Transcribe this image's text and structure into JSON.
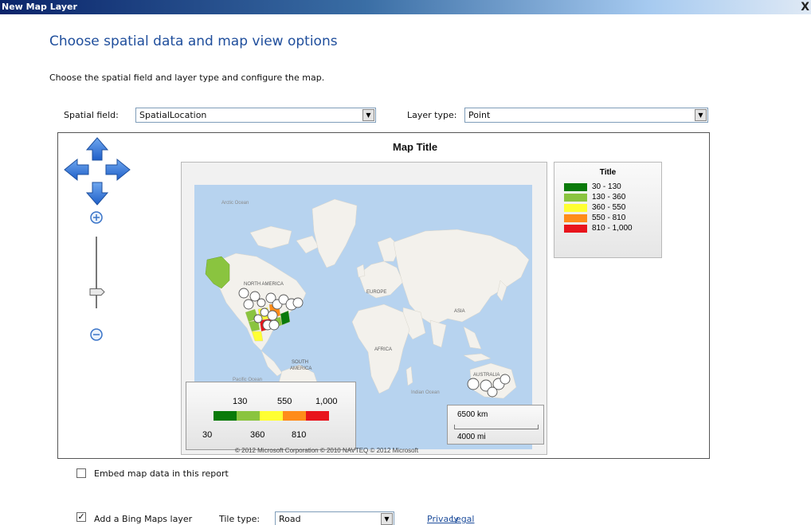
{
  "window": {
    "title": "New Map Layer",
    "close_label": "X"
  },
  "page": {
    "heading": "Choose spatial data and map view options",
    "subheading": "Choose the spatial field and layer type and configure the map."
  },
  "spatial_field": {
    "label": "Spatial field:",
    "value": "SpatialLocation"
  },
  "layer_type": {
    "label": "Layer type:",
    "value": "Point"
  },
  "map": {
    "title": "Map Title",
    "place_labels": {
      "arctic": "Arctic Ocean",
      "north_america": "NORTH AMERICA",
      "europe": "EUROPE",
      "asia": "ASIA",
      "africa": "AFRICA",
      "south_america_1": "SOUTH",
      "south_america_2": "AMERICA",
      "pacific": "Pacific Ocean",
      "indian": "Indian Ocean",
      "australia": "AUSTRALIA"
    },
    "legend": {
      "title": "Title",
      "items": [
        {
          "label": "30 - 130",
          "color": "#0a7a0a"
        },
        {
          "label": "130 - 360",
          "color": "#8ac43f"
        },
        {
          "label": "360 - 550",
          "color": "#ffff33"
        },
        {
          "label": "550 - 810",
          "color": "#ff8c1a"
        },
        {
          "label": "810 - 1,000",
          "color": "#e8141c"
        }
      ]
    },
    "color_scale": {
      "top_labels": [
        "130",
        "550",
        "1,000"
      ],
      "bottom_labels": [
        "30",
        "360",
        "810"
      ],
      "colors": [
        "#0a7a0a",
        "#8ac43f",
        "#ffff33",
        "#ff8c1a",
        "#e8141c"
      ]
    },
    "distance_scale": {
      "km": "6500 km",
      "mi": "4000 mi"
    },
    "attribution": "© 2012 Microsoft Corporation  © 2010 NAVTEQ  © 2012 Microsoft",
    "zoom_level": 0.25
  },
  "embed": {
    "label": "Embed map data in this report",
    "checked": false
  },
  "bing": {
    "label": "Add a Bing Maps layer",
    "checked": true,
    "tile_type_label": "Tile type:",
    "tile_type_value": "Road",
    "privacy": "Privacy",
    "legal": "Legal"
  }
}
